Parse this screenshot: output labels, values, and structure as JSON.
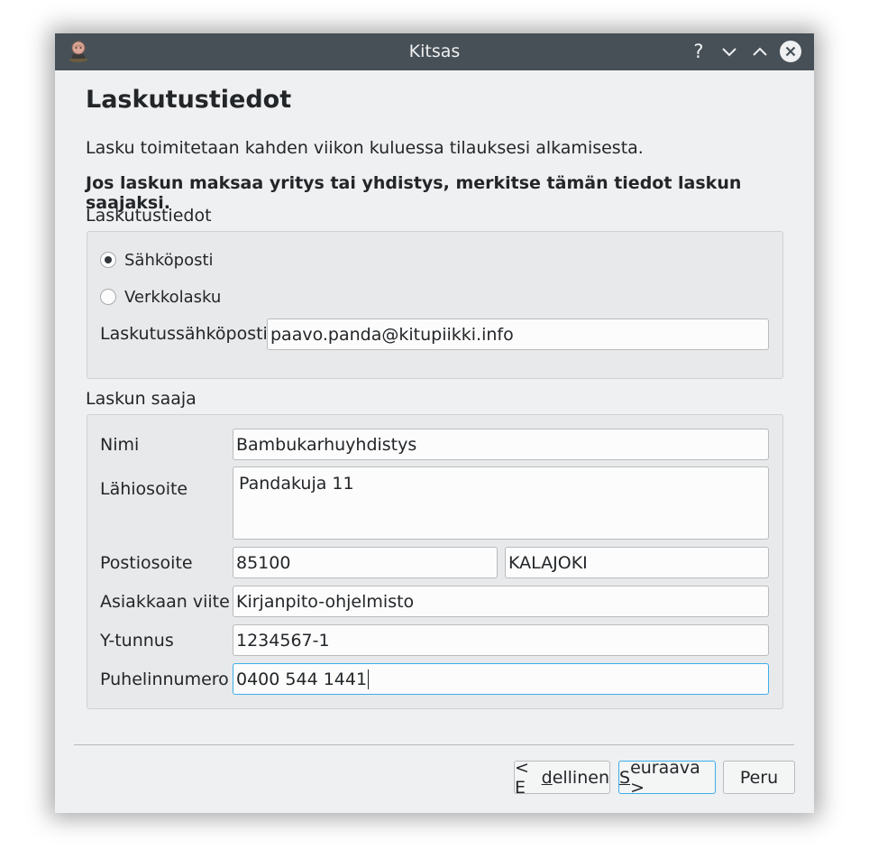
{
  "window": {
    "title": "Kitsas",
    "help_glyph": "?"
  },
  "page": {
    "heading": "Laskutustiedot",
    "description": "Lasku toimitetaan kahden viikon kuluessa tilauksesi alkamisesta.",
    "notice": "Jos laskun maksaa yritys tai yhdistys, merkitse tämän tiedot laskun saajaksi."
  },
  "billing": {
    "group_label": "Laskutustiedot",
    "options": [
      {
        "label": "Sähköposti",
        "selected": true
      },
      {
        "label": "Verkkolasku",
        "selected": false
      }
    ],
    "email_label": "Laskutussähköposti",
    "email_value": "paavo.panda@kitupiikki.info"
  },
  "recipient": {
    "group_label": "Laskun saaja",
    "name_label": "Nimi",
    "name_value": "Bambukarhuyhdistys",
    "address_label": "Lähiosoite",
    "address_value": "Pandakuja 11",
    "postal_label": "Postiosoite",
    "postal_code": "85100",
    "city": "KALAJOKI",
    "reference_label": "Asiakkaan viite",
    "reference_value": "Kirjanpito-ohjelmisto",
    "business_id_label": "Y-tunnus",
    "business_id_value": "1234567-1",
    "phone_label": "Puhelinnumero",
    "phone_value": "0400 544 1441"
  },
  "buttons": {
    "back_prefix": "< E",
    "back_mnemonic": "d",
    "back_suffix": "ellinen",
    "next_mnemonic": "S",
    "next_suffix": "euraava >",
    "cancel": "Peru"
  },
  "colors": {
    "titlebar": "#475057",
    "window_bg": "#eff0f1",
    "focus": "#3daee9"
  },
  "icons": {
    "app": "app-avatar-icon",
    "minimize": "chevron-down-icon",
    "maximize": "chevron-up-icon",
    "close": "close-icon"
  }
}
